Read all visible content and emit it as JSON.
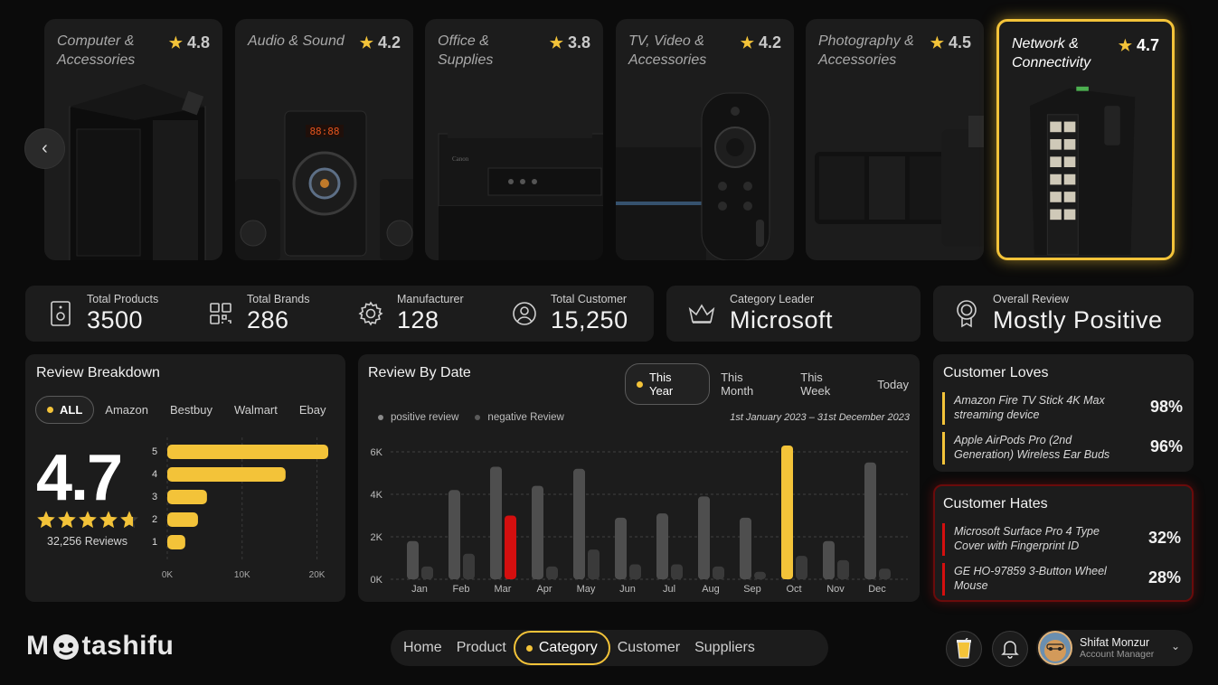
{
  "categories": [
    {
      "title": "Computer & Accessories",
      "rating": "4.8",
      "icon": "computer-tower"
    },
    {
      "title": "Audio & Sound",
      "rating": "4.2",
      "icon": "speaker"
    },
    {
      "title": "Office & Supplies",
      "rating": "3.8",
      "icon": "printer"
    },
    {
      "title": "TV, Video & Accessories",
      "rating": "4.2",
      "icon": "remote"
    },
    {
      "title": "Photography & Accessories",
      "rating": "4.5",
      "icon": "camera"
    },
    {
      "title": "Network & Connectivity",
      "rating": "4.7",
      "icon": "network-switch"
    }
  ],
  "stats": {
    "total_products": {
      "label": "Total Products",
      "value": "3500"
    },
    "total_brands": {
      "label": "Total Brands",
      "value": "286"
    },
    "manufacturer": {
      "label": "Manufacturer",
      "value": "128"
    },
    "total_customer": {
      "label": "Total Customer",
      "value": "15,250"
    },
    "category_leader": {
      "label": "Category Leader",
      "value": "Microsoft"
    },
    "overall_review": {
      "label": "Overall Review",
      "value": "Mostly Positive"
    }
  },
  "review_breakdown": {
    "title": "Review Breakdown",
    "tabs": [
      "ALL",
      "Amazon",
      "Bestbuy",
      "Walmart",
      "Ebay"
    ],
    "active_tab": "ALL",
    "score": "4.7",
    "stars": 4.7,
    "reviews_label": "32,256 Reviews"
  },
  "review_by_date": {
    "title": "Review By Date",
    "tabs": [
      "This Year",
      "This Month",
      "This Week",
      "Today"
    ],
    "active_tab": "This Year",
    "legend": [
      "positive review",
      "negative Review"
    ],
    "date_range": "1st January 2023 – 31st December 2023"
  },
  "chart_data": [
    {
      "type": "bar",
      "orientation": "horizontal",
      "categories": [
        "5",
        "4",
        "3",
        "2",
        "1"
      ],
      "values": [
        21500,
        15800,
        5300,
        4100,
        2400
      ],
      "xlim": [
        0,
        21500
      ],
      "xticks": [
        "0K",
        "10K",
        "20K"
      ],
      "color": "#f3c339",
      "grid": true
    },
    {
      "type": "bar",
      "categories": [
        "Jan",
        "Feb",
        "Mar",
        "Apr",
        "May",
        "Jun",
        "Jul",
        "Aug",
        "Sep",
        "Oct",
        "Nov",
        "Dec"
      ],
      "series": [
        {
          "name": "positive review",
          "values": [
            1800,
            4200,
            5300,
            4400,
            5200,
            2900,
            3100,
            3900,
            2900,
            6300,
            1800,
            5500
          ]
        },
        {
          "name": "negative Review",
          "values": [
            600,
            1200,
            3000,
            600,
            1400,
            700,
            700,
            600,
            350,
            1100,
            900,
            500
          ]
        }
      ],
      "ylim": [
        0,
        6000
      ],
      "yticks": [
        "0K",
        "2K",
        "4K",
        "6K"
      ],
      "highlights": {
        "positive review": {
          "Oct": "#f3c339"
        },
        "negative Review": {
          "Mar": "#d40f0f"
        }
      },
      "grid": true
    }
  ],
  "customer_loves": {
    "title": "Customer Loves",
    "items": [
      {
        "name": "Amazon Fire TV Stick 4K Max streaming device",
        "pct": "98%"
      },
      {
        "name": "Apple AirPods Pro (2nd Generation) Wireless Ear Buds",
        "pct": "96%"
      }
    ]
  },
  "customer_hates": {
    "title": "Customer Hates",
    "items": [
      {
        "name": "Microsoft Surface Pro 4 Type Cover with Fingerprint ID",
        "pct": "32%"
      },
      {
        "name": "GE HO-97859 3-Button Wheel Mouse",
        "pct": "28%"
      }
    ]
  },
  "brand": {
    "logo_prefix": "M",
    "logo_suffix": "tashifu"
  },
  "nav": {
    "items": [
      "Home",
      "Product",
      "Category",
      "Customer",
      "Suppliers"
    ],
    "active": "Category"
  },
  "user": {
    "name": "Shifat Monzur",
    "role": "Account Manager"
  },
  "colors": {
    "accent": "#f3c339",
    "negative": "#d40f0f",
    "panel": "#1c1c1c",
    "background": "#0b0b0b"
  }
}
